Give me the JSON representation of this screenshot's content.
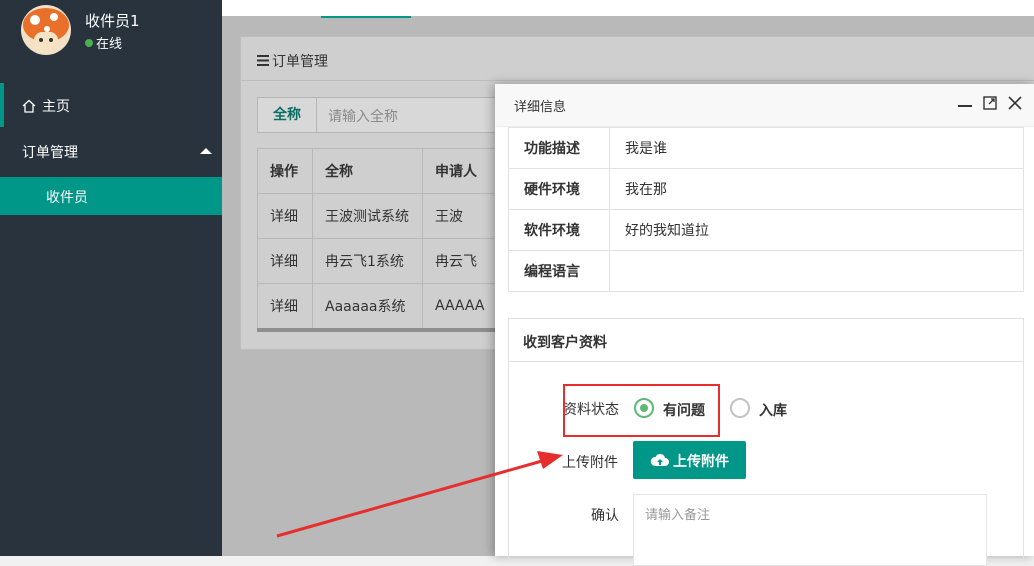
{
  "sidebar": {
    "user_name": "收件员1",
    "status": "在线",
    "home": "主页",
    "group": "订单管理",
    "sub_item": "收件员"
  },
  "panel": {
    "title": "订单管理",
    "search_label": "全称",
    "search_placeholder": "请输入全称",
    "columns": [
      "操作",
      "全称",
      "申请人"
    ],
    "rows": [
      {
        "action": "详细",
        "name": "王波测试系统",
        "applicant": "王波"
      },
      {
        "action": "详细",
        "name": "冉云飞1系统",
        "applicant": "冉云飞"
      },
      {
        "action": "详细",
        "name": "Aaaaaa系统",
        "applicant": "AAAAA"
      }
    ]
  },
  "dialog": {
    "title": "详细信息",
    "info": [
      {
        "key": "功能描述",
        "value": "我是谁"
      },
      {
        "key": "硬件环境",
        "value": "我在那"
      },
      {
        "key": "软件环境",
        "value": "好的我知道拉"
      },
      {
        "key": "编程语言",
        "value": ""
      }
    ],
    "section_title": "收到客户资料",
    "status_label": "资料状态",
    "radio_issue": "有问题",
    "radio_stored": "入库",
    "upload_label": "上传附件",
    "upload_button": "上传附件",
    "confirm_label": "确认",
    "remark_placeholder": "请输入备注"
  },
  "colors": {
    "accent": "#009688",
    "sidebar_bg": "#28333e",
    "radio_checked": "#5fb878",
    "annotation": "#e62e2e"
  }
}
